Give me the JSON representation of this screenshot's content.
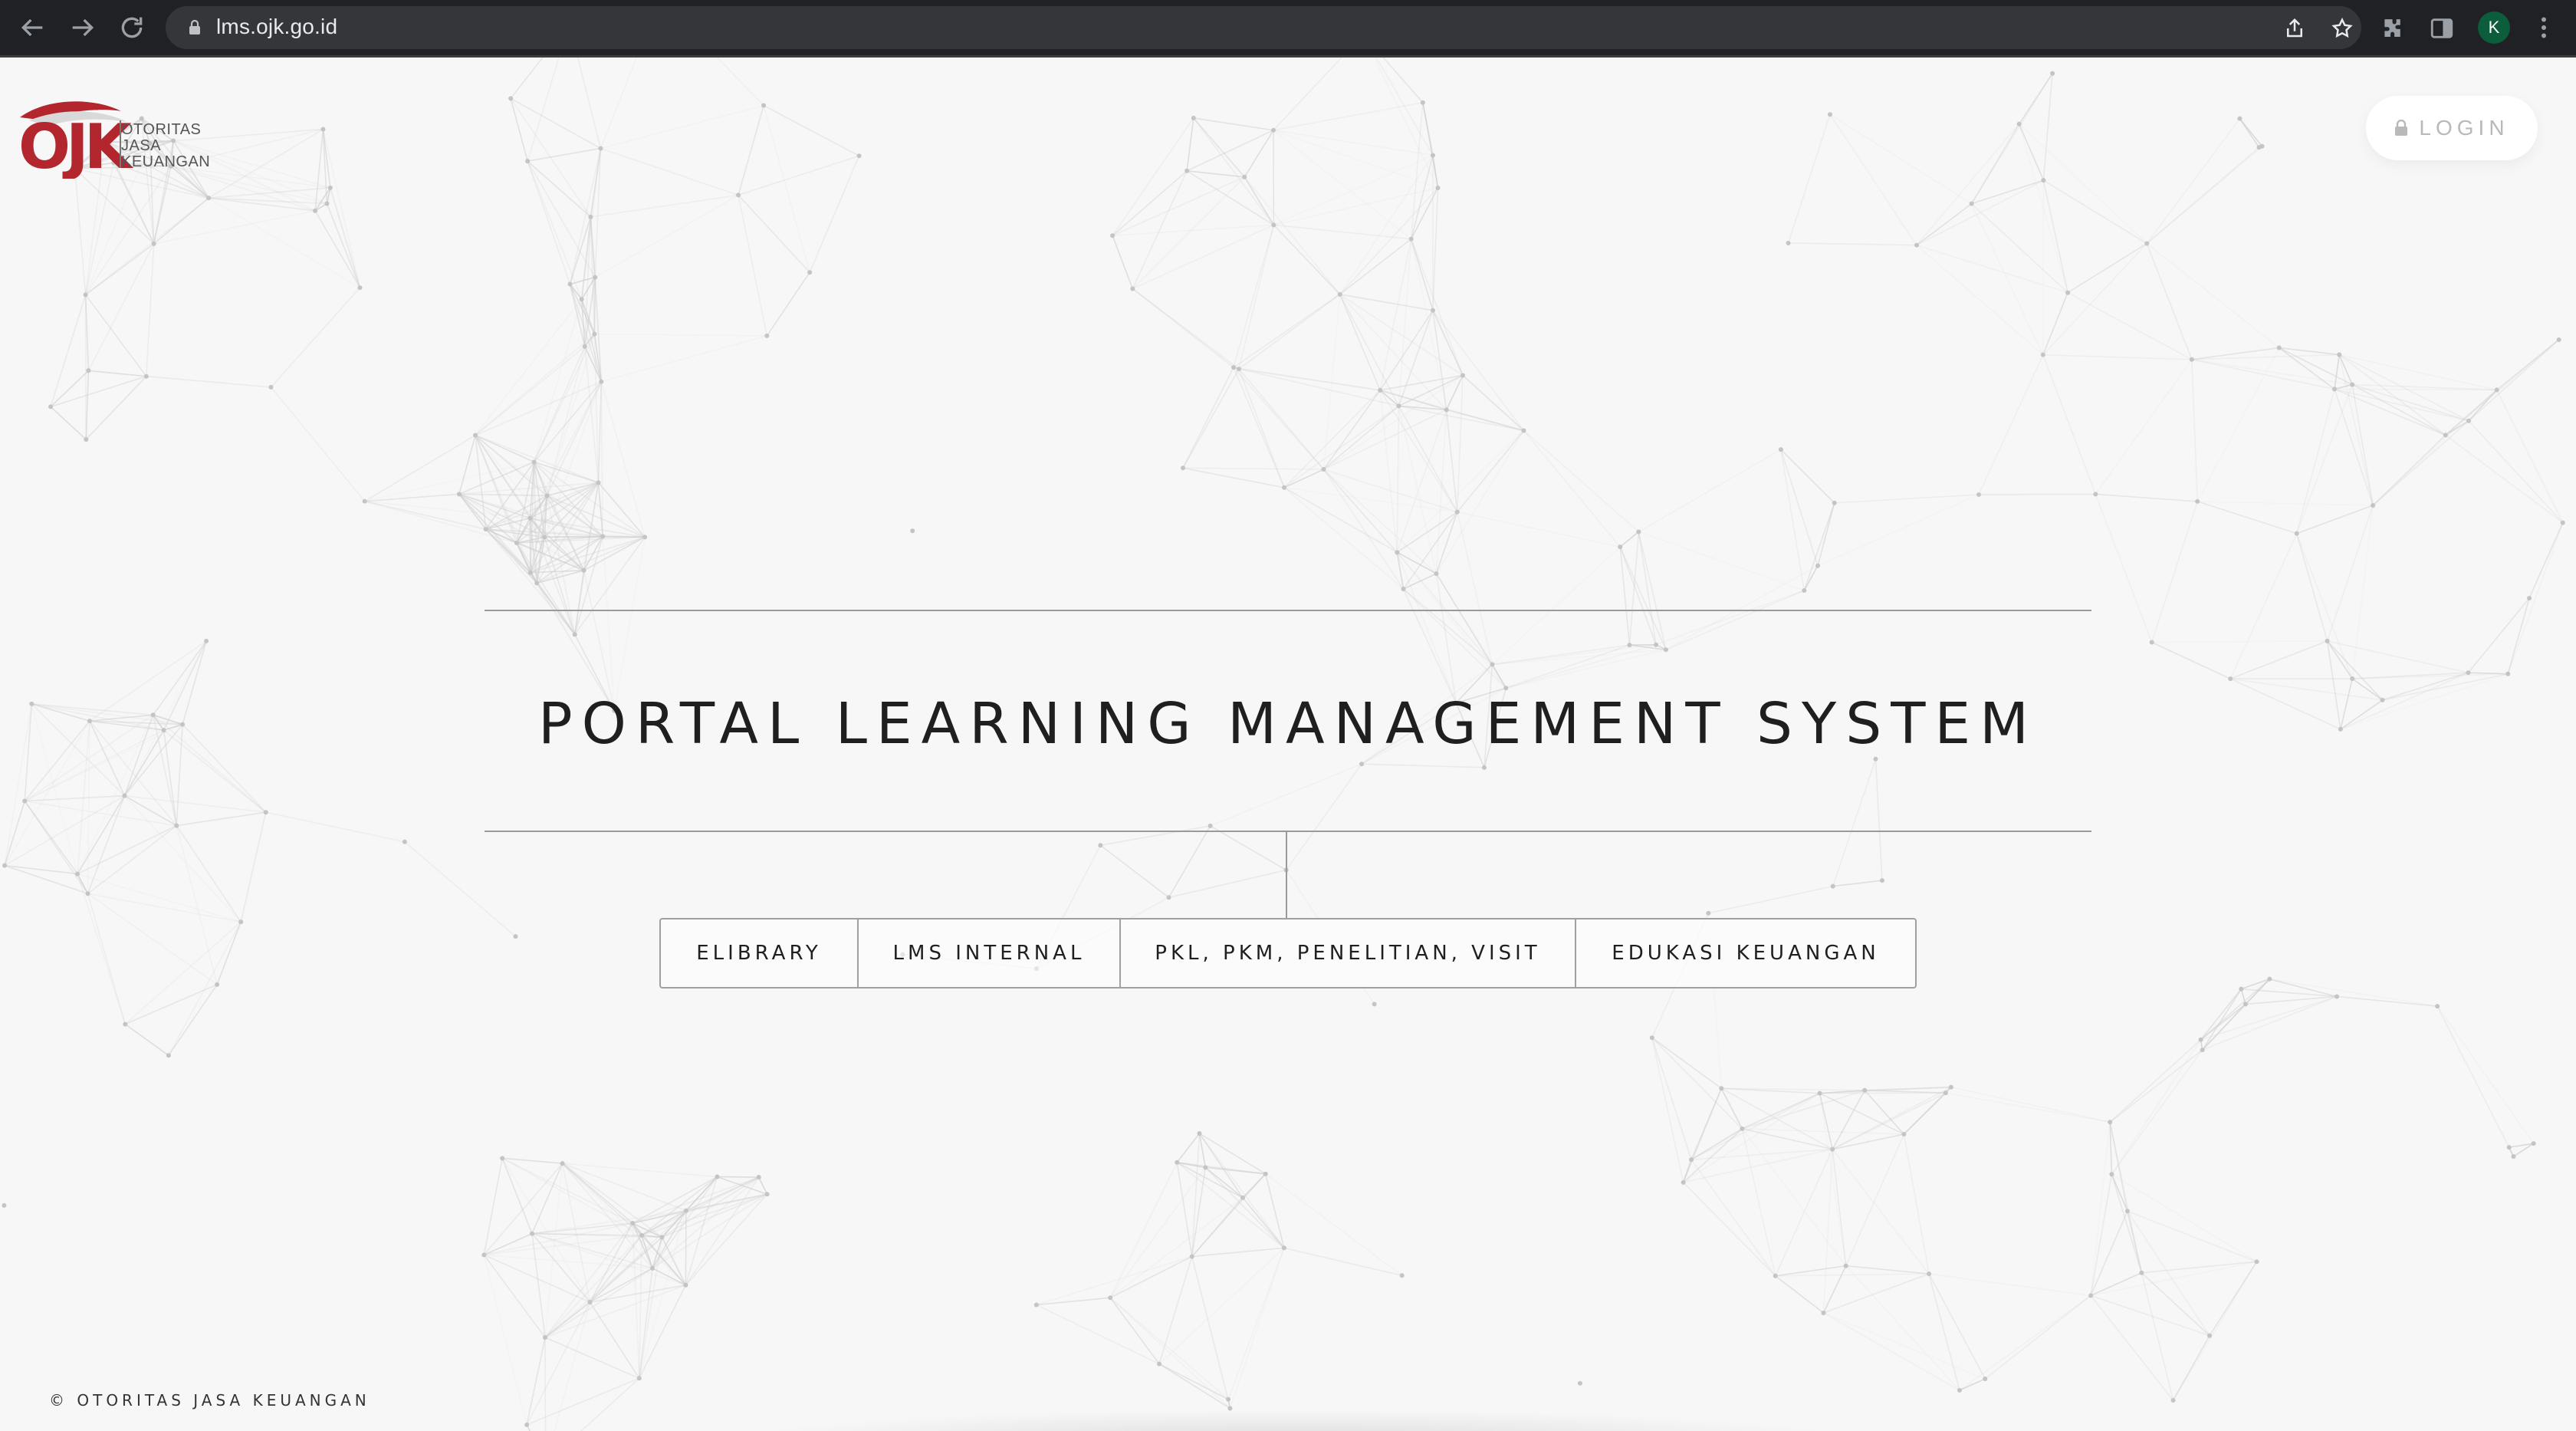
{
  "browser": {
    "url": "lms.ojk.go.id",
    "profile_initial": "K",
    "icons": {
      "back": "arrow-left-icon",
      "forward": "arrow-right-icon",
      "reload": "reload-icon",
      "secure": "lock-icon",
      "share": "share-icon",
      "bookmark": "star-icon",
      "extensions": "puzzle-icon",
      "side_panel": "side-panel-icon",
      "menu": "kebab-menu-icon"
    }
  },
  "header": {
    "logo": {
      "mark": "OJK",
      "line1": "OTORITAS",
      "line2": "JASA",
      "line3": "KEUANGAN",
      "brand_red": "#b3262d"
    },
    "login_label": "LOGIN",
    "login_icon": "lock-icon"
  },
  "main": {
    "title": "PORTAL LEARNING MANAGEMENT SYSTEM",
    "menu": [
      {
        "label": "ELIBRARY"
      },
      {
        "label": "LMS INTERNAL"
      },
      {
        "label": "PKL, PKM, PENELITIAN, VISIT"
      },
      {
        "label": "EDUKASI KEUANGAN"
      }
    ]
  },
  "footer": {
    "copyright": "© OTORITAS JASA KEUANGAN"
  },
  "colors": {
    "page_background": "#f7f7f7",
    "text": "#1f1f1f",
    "chrome": "#202124",
    "omnibox": "#35363a",
    "avatar": "#0b5d3b"
  }
}
